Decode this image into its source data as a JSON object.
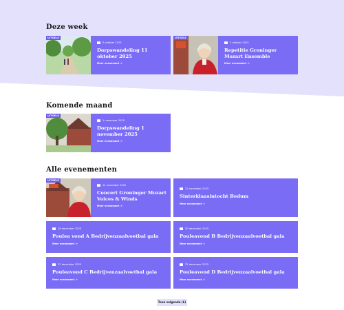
{
  "sections": {
    "week": "Deze week",
    "month": "Komende maand",
    "all": "Alle evenementen"
  },
  "more_label": "Meer evenement",
  "arrow": "»",
  "cards": [
    {
      "date": "5 oktober 2025",
      "title": "Dorpswandeling 11 oktober 2025",
      "tag": "UITGELE"
    },
    {
      "date": "5 oktober 2025",
      "title": "Repetitie Groninger Mozart Ensemble",
      "tag": "UITGELE"
    },
    {
      "date": "1 november 2025",
      "title": "Dorpswandeling 1 november 2025",
      "tag": "UITGELE"
    },
    {
      "date": "14 november 2025",
      "title": "Concert Groninger Mozart Voices & Winds",
      "tag": "UITGELE"
    },
    {
      "date": "22 november 2025",
      "title": "Sinterklaasintocht Bedum"
    },
    {
      "date": "18 december 2025",
      "title": "Poulea vond A Bedrijvenzaalvoetbal gala"
    },
    {
      "date": "20 december 2025",
      "title": "Pouleavond B Bedrijvenzaalvoetbal gala"
    },
    {
      "date": "22 december 2025",
      "title": "Pouleavond C Bedrijvenzaalvoetbal gala"
    },
    {
      "date": "22 december 2025",
      "title": "Pouleavond D Bedrijvenzaalvoetbal gala"
    }
  ],
  "show_more_button": "Toon volgende (6)",
  "colors": {
    "accent": "#7b6cf6",
    "band": "#e4e1fd",
    "text": "#161616"
  }
}
